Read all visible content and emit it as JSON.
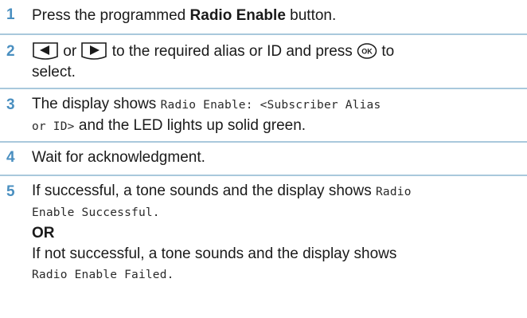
{
  "steps": [
    {
      "number": "1",
      "pre": "Press the programmed ",
      "bold": "Radio Enable",
      "post": " button."
    },
    {
      "number": "2",
      "icons": [
        "left-arrow-key-icon",
        "right-arrow-key-icon",
        "ok-button-icon"
      ],
      "or_text": "or",
      "mid": "to the required alias or ID and press",
      "end_line1": "to",
      "line2": "select."
    },
    {
      "number": "3",
      "pre": "The display shows ",
      "mono1": "Radio Enable: <Subscriber Alias",
      "mono2": "or ID>",
      "post": " and the LED lights up solid green."
    },
    {
      "number": "4",
      "text": "Wait for acknowledgment."
    },
    {
      "number": "5",
      "line1_pre": "If successful, a tone sounds and the display shows ",
      "line1_mono": "Radio",
      "line2_mono": "Enable Successful.",
      "or_label": "OR",
      "line4": "If not successful, a tone sounds and the display shows",
      "line5_mono": "Radio Enable Failed."
    }
  ]
}
